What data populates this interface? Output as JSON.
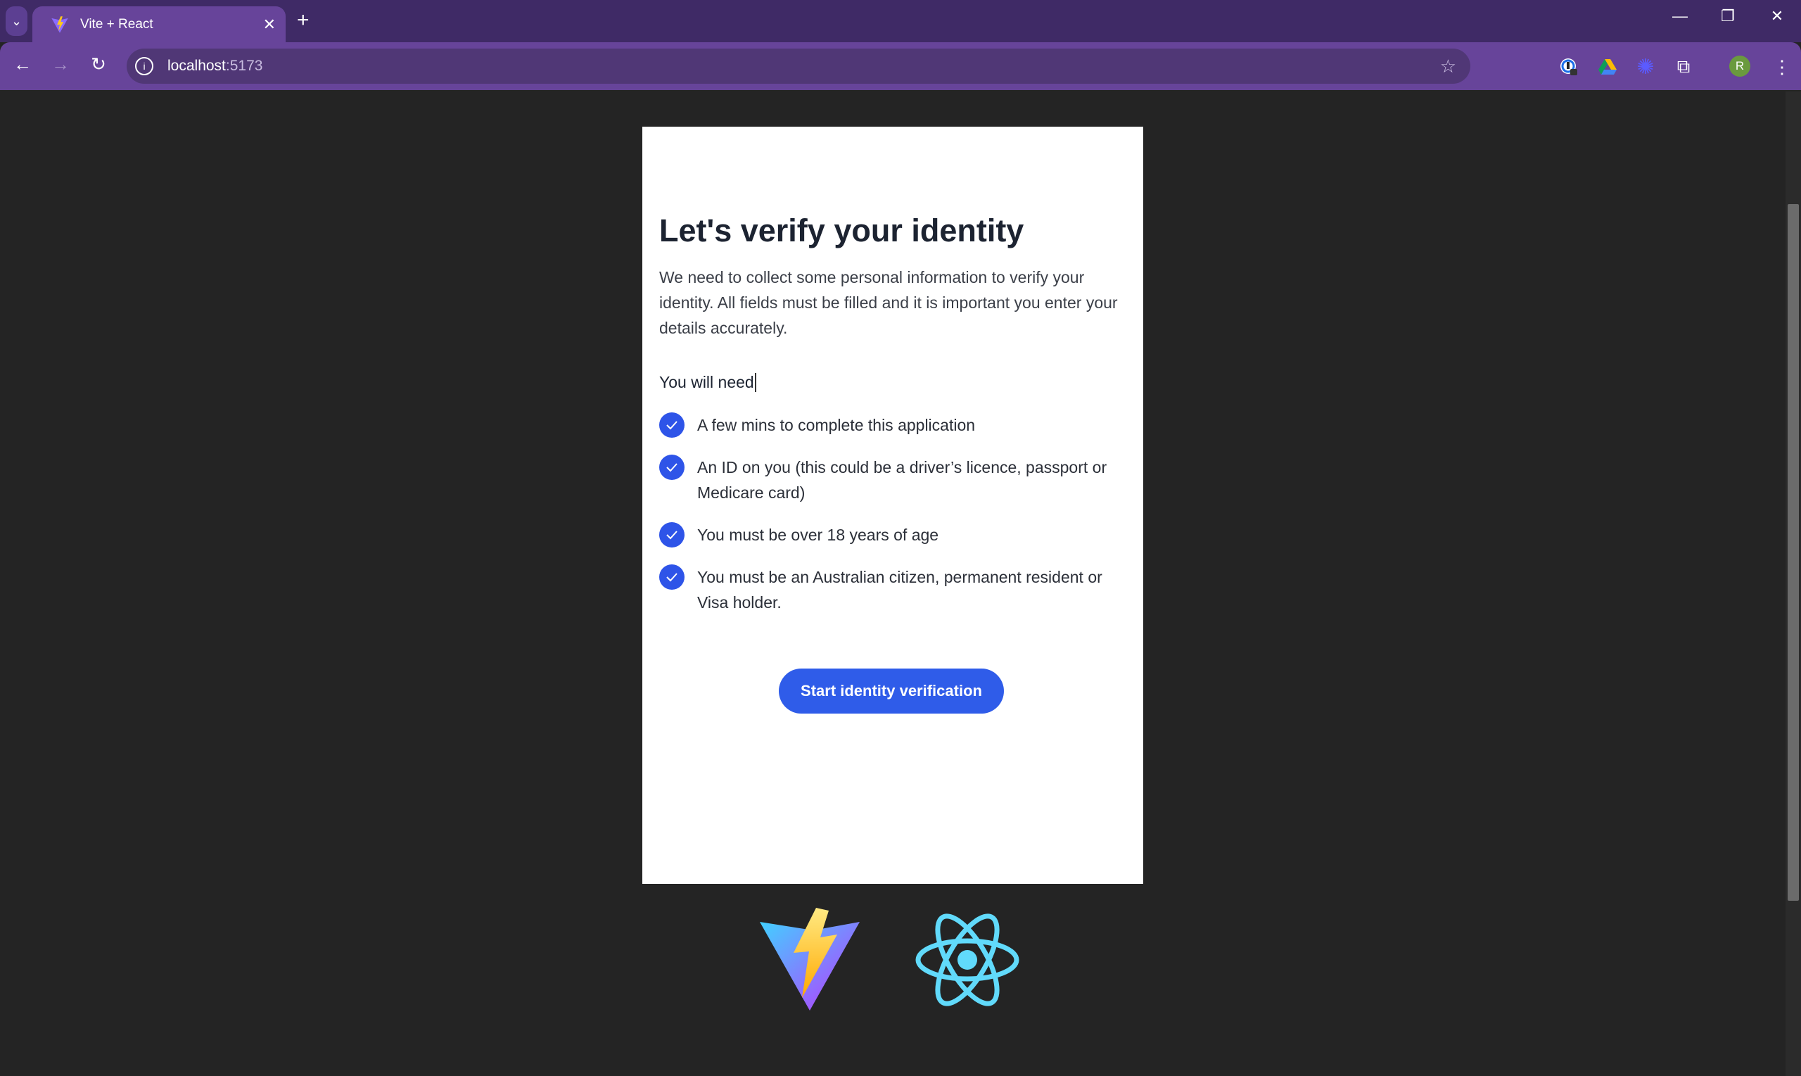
{
  "browser": {
    "tab_title": "Vite + React",
    "url_host": "localhost",
    "url_port": ":5173",
    "profile_initial": "R",
    "icons": [
      "tab-search-icon",
      "vite-favicon-icon",
      "close-icon",
      "new-tab-icon",
      "minimize-icon",
      "restore-icon",
      "window-close-icon",
      "back-icon",
      "forward-icon",
      "reload-icon",
      "site-info-icon",
      "bookmark-star-icon",
      "password-manager-icon",
      "google-drive-icon",
      "sparkle-extension-icon",
      "extensions-puzzle-icon",
      "more-menu-icon"
    ]
  },
  "card": {
    "title": "Let's verify your identity",
    "intro": "We need to collect some personal information to verify your identity. All fields must be filled and it is important you enter your details accurately.",
    "need_heading": "You will need",
    "requirements": [
      "A few mins to complete this application",
      "An ID on you (this could be a driver’s licence, passport or Medicare card)",
      "You must be over 18 years of age",
      "You must be an Australian citizen, permanent resident or Visa holder."
    ],
    "button_label": "Start identity verification"
  },
  "colors": {
    "accent": "#2f5ce9",
    "browser_frame": "#67449a",
    "page_bg": "#242424"
  }
}
